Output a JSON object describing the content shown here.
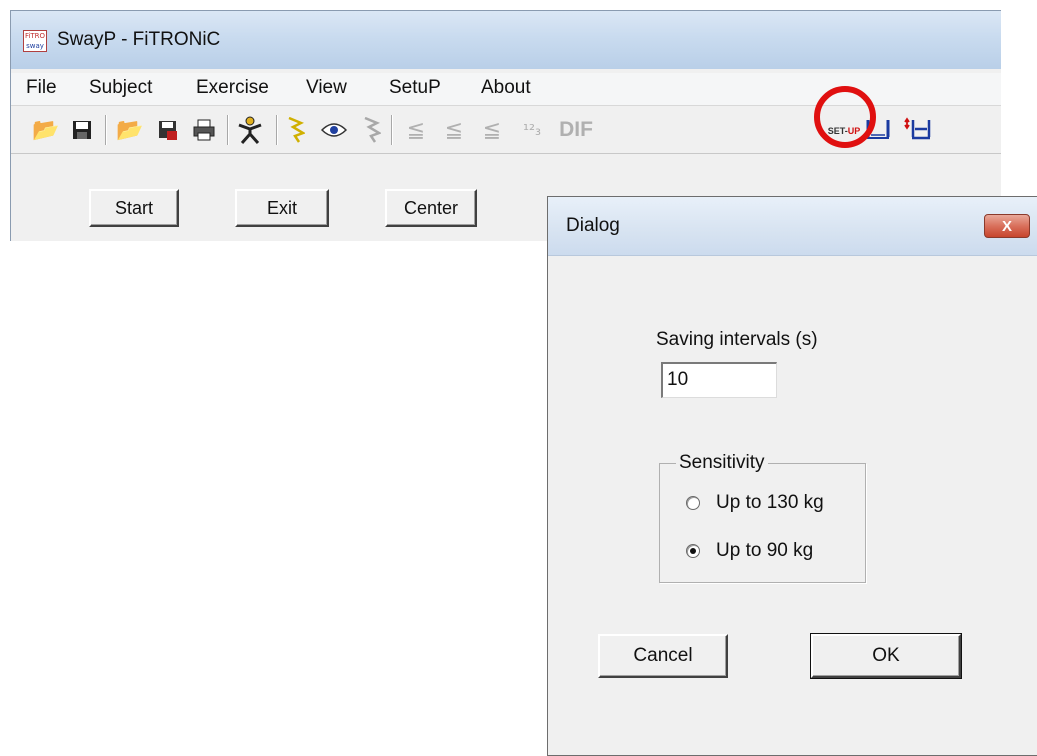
{
  "app": {
    "title": "SwayP - FiTRONiC",
    "icon_text_top": "FiTRO",
    "icon_text_bottom": "sway"
  },
  "menu": [
    "File",
    "Subject",
    "Exercise",
    "View",
    "SetuP",
    "About"
  ],
  "toolbar": {
    "icons": [
      "open-folder-icon",
      "save-disk-icon",
      "open-subject-icon",
      "save-subject-icon",
      "print-icon",
      "person-icon",
      "lightning-icon",
      "eye-icon",
      "lightning-disabled-icon",
      "measure-icon",
      "measure-i-icon",
      "measure-m-icon",
      "number-icon",
      "diff-icon",
      "setup-icon",
      "scale-icon",
      "scale-d-icon"
    ],
    "diff_label": "DIF",
    "setup_label_top": "SET-",
    "setup_label_bottom": "UP",
    "setup_highlight_color": "#e01010"
  },
  "main_buttons": {
    "start": "Start",
    "exit": "Exit",
    "center": "Center"
  },
  "dialog": {
    "title": "Dialog",
    "close_label": "X",
    "saving_label": "Saving intervals (s)",
    "saving_value": "10",
    "sensitivity_label": "Sensitivity",
    "options": [
      {
        "label": "Up to 130 kg",
        "selected": false
      },
      {
        "label": "Up to 90 kg",
        "selected": true
      }
    ],
    "cancel": "Cancel",
    "ok": "OK"
  }
}
